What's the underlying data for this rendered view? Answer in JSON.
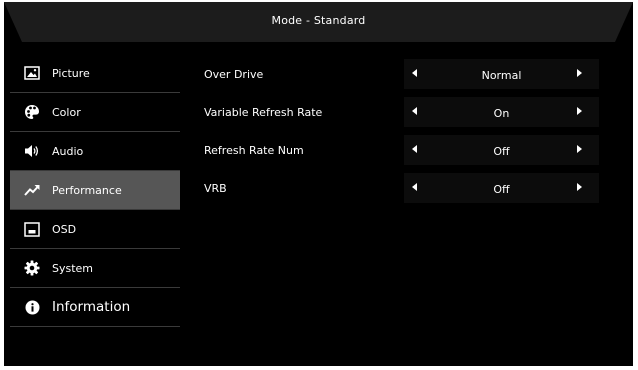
{
  "header": {
    "title": "Mode - Standard"
  },
  "sidebar": {
    "items": [
      {
        "label": "Picture",
        "icon": "picture-icon"
      },
      {
        "label": "Color",
        "icon": "palette-icon"
      },
      {
        "label": "Audio",
        "icon": "speaker-icon"
      },
      {
        "label": "Performance",
        "icon": "performance-icon",
        "active": true
      },
      {
        "label": "OSD",
        "icon": "osd-icon"
      },
      {
        "label": "System",
        "icon": "gear-icon"
      },
      {
        "label": "Information",
        "icon": "info-icon"
      }
    ]
  },
  "settings": {
    "rows": [
      {
        "label": "Over Drive",
        "value": "Normal"
      },
      {
        "label": "Variable Refresh Rate",
        "value": "On"
      },
      {
        "label": "Refresh Rate Num",
        "value": "Off"
      },
      {
        "label": "VRB",
        "value": "Off"
      }
    ]
  },
  "colors": {
    "background": "#000000",
    "title_bar": "#1c1c1c",
    "active_item": "#565656",
    "selector_bg": "#0c0c0c",
    "text": "#ffffff"
  }
}
